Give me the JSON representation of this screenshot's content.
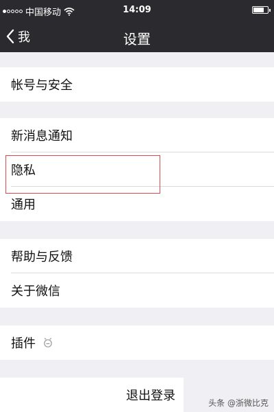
{
  "status_bar": {
    "carrier": "中国移动",
    "time": "14:09",
    "signal_filled": 1,
    "signal_total": 5
  },
  "nav": {
    "back_label": "我",
    "title": "设置"
  },
  "groups": [
    {
      "items": [
        {
          "label": "帐号与安全"
        }
      ]
    },
    {
      "items": [
        {
          "label": "新消息通知"
        },
        {
          "label": "隐私"
        },
        {
          "label": "通用"
        }
      ]
    },
    {
      "items": [
        {
          "label": "帮助与反馈"
        },
        {
          "label": "关于微信"
        }
      ]
    },
    {
      "items": [
        {
          "label": "插件",
          "icon": "plugin-icon"
        }
      ]
    }
  ],
  "logout": {
    "label": "退出登录"
  },
  "watermark": {
    "text": "头条 @浙微比克"
  },
  "colors": {
    "bar_bg": "#2b2b2f",
    "page_bg": "#efeff4",
    "highlight": "#d94a4a"
  }
}
